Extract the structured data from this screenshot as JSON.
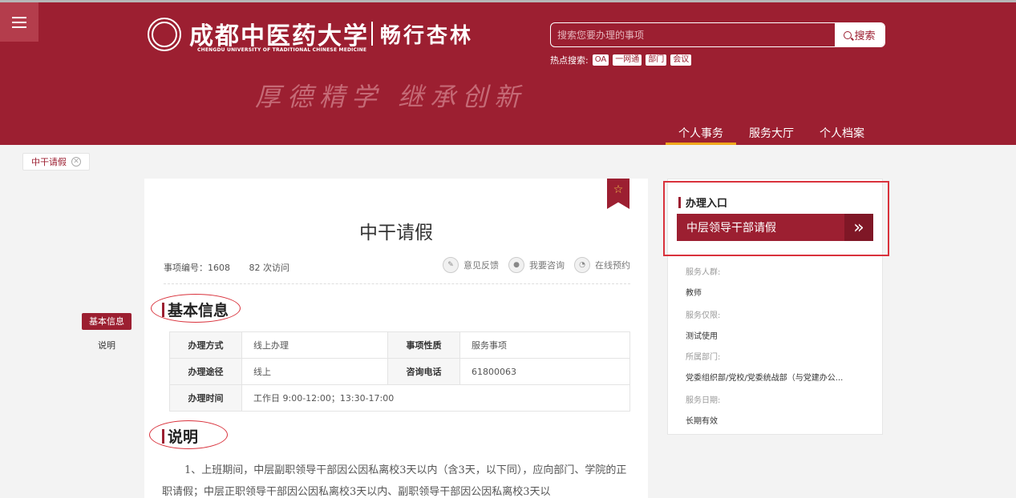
{
  "header": {
    "logo_cn": "成都中医药大学",
    "logo_en": "CHENGDU UNIVERSITY OF TRADITIONAL CHINESE MEDICINE",
    "system_name": "畅行杏林",
    "motto": "厚德精学 继承创新",
    "search": {
      "placeholder": "搜索您要办理的事项",
      "button": "搜索"
    },
    "hot_label": "热点搜索:",
    "hot_tags": [
      "OA",
      "一网通",
      "部门",
      "会议"
    ],
    "nav": [
      "个人事务",
      "服务大厅",
      "个人档案"
    ],
    "nav_active": "个人事务",
    "brand_color": "#9c1f31"
  },
  "tab": {
    "label": "中干请假"
  },
  "sidenav": [
    "基本信息",
    "说明"
  ],
  "main": {
    "title": "中干请假",
    "item_no": "事项编号：1608",
    "visits": "82 次访问",
    "actions": [
      "意见反馈",
      "我要咨询",
      "在线预约"
    ],
    "section_basic": "基本信息",
    "section_desc": "说明",
    "table": [
      {
        "k1": "办理方式",
        "v1": "线上办理",
        "k2": "事项性质",
        "v2": "服务事项"
      },
      {
        "k1": "办理途径",
        "v1": "线上",
        "k2": "咨询电话",
        "v2": "61800063"
      },
      {
        "k1": "办理时间",
        "v1": "工作日 9:00-12:00；13:30-17:00"
      }
    ],
    "desc_text": "1、上班期间，中层副职领导干部因公因私离校3天以内（含3天，以下同），应向部门、学院的正职请假；中层正职领导干部因公因私离校3天以内、副职领导干部因公因私离校3天以"
  },
  "right": {
    "entry_title": "办理入口",
    "entry_button": "中层领导干部请假",
    "fields": [
      {
        "label": "服务人群:",
        "value": "教师"
      },
      {
        "label": "服务仅限:",
        "value": "测试使用"
      },
      {
        "label": "所属部门:",
        "value": "党委组织部/党校/党委统战部（与党建办公..."
      },
      {
        "label": "服务日期:",
        "value": "长期有效"
      }
    ]
  }
}
